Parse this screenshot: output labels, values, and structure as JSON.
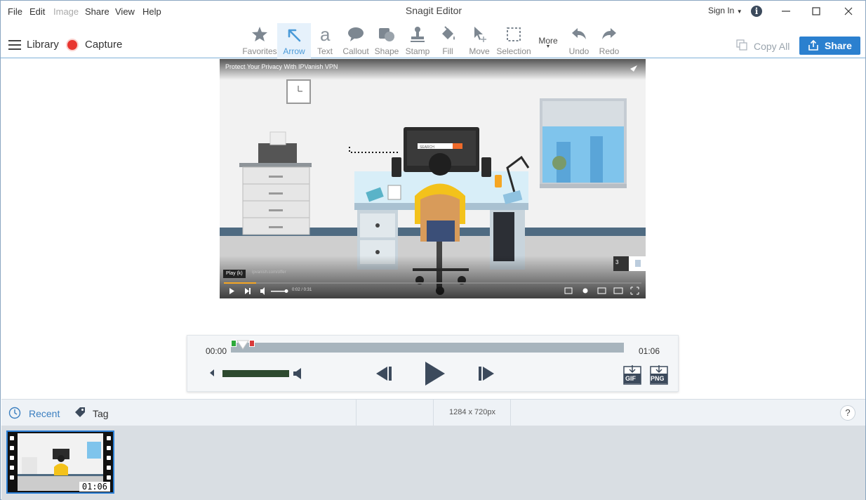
{
  "menu": {
    "items": [
      {
        "label": "File",
        "enabled": true
      },
      {
        "label": "Edit",
        "enabled": true
      },
      {
        "label": "Image",
        "enabled": false
      },
      {
        "label": "Share",
        "enabled": true
      },
      {
        "label": "View",
        "enabled": true
      },
      {
        "label": "Help",
        "enabled": true
      }
    ]
  },
  "window": {
    "title": "Snagit Editor",
    "sign_in": "Sign In",
    "controls": [
      "minimize-icon",
      "maximize-icon",
      "close-icon"
    ]
  },
  "toolbar": {
    "library": "Library",
    "capture": "Capture",
    "tools": [
      {
        "label": "Favorites",
        "icon": "star-icon"
      },
      {
        "label": "Arrow",
        "icon": "arrow-icon",
        "active": true
      },
      {
        "label": "Text",
        "icon": "text-icon"
      },
      {
        "label": "Callout",
        "icon": "callout-icon"
      },
      {
        "label": "Shape",
        "icon": "shape-icon"
      },
      {
        "label": "Stamp",
        "icon": "stamp-icon"
      },
      {
        "label": "Fill",
        "icon": "fill-icon"
      },
      {
        "label": "Move",
        "icon": "move-icon"
      },
      {
        "label": "Selection",
        "icon": "selection-icon"
      },
      {
        "label": "More",
        "icon": "more-icon"
      },
      {
        "label": "Undo",
        "icon": "undo-icon"
      },
      {
        "label": "Redo",
        "icon": "redo-icon"
      }
    ],
    "copy_all": "Copy All",
    "share": "Share"
  },
  "video": {
    "title": "Protect Your Privacy With IPVanish VPN",
    "play_tooltip": "Play (k)",
    "url": "ipvanish.com/offer",
    "time": "0:02 / 0:31",
    "card_count": "3"
  },
  "player": {
    "start_time": "00:00",
    "end_time": "01:06",
    "volume": 0.85,
    "gif_label": "GIF",
    "png_label": "PNG"
  },
  "bottombar": {
    "recent": "Recent",
    "tag": "Tag",
    "dimensions": "1284 x 720px",
    "help": "?"
  },
  "tray": {
    "items": [
      {
        "duration": "01:06",
        "selected": true
      }
    ]
  },
  "colors": {
    "accent": "#2b80cf",
    "active_tool": "#4a9ad8",
    "record": "#e8352f"
  }
}
